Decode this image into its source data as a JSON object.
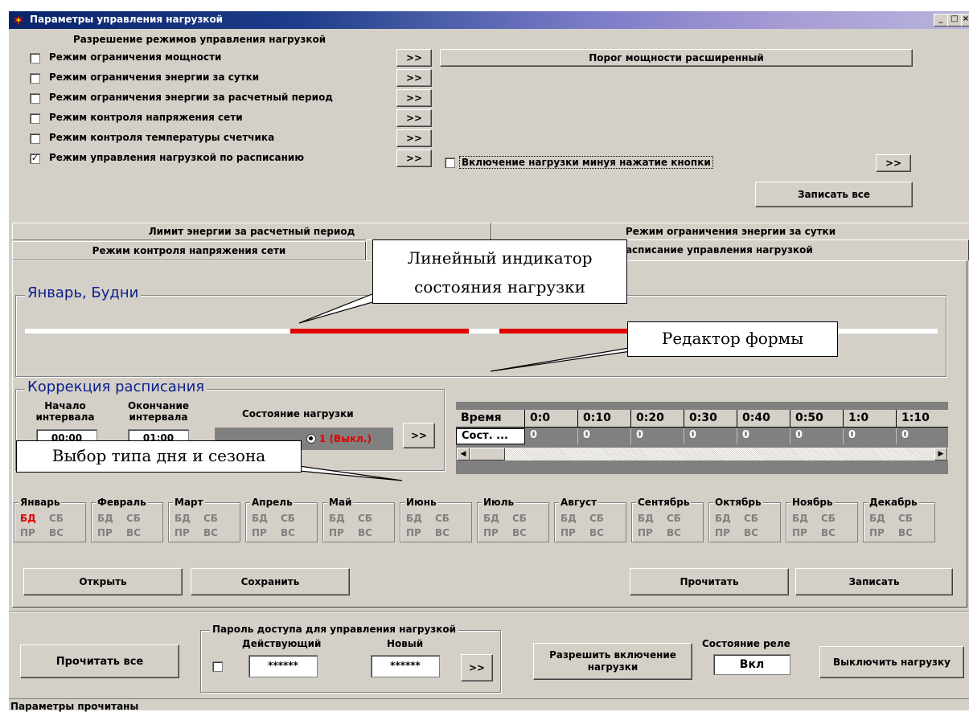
{
  "window": {
    "title": "Параметры управления нагрузкой"
  },
  "modes": {
    "caption": "Разрешение режимов управления нагрузкой",
    "items": [
      {
        "label": "Режим ограничения мощности",
        "checked": false
      },
      {
        "label": "Режим ограничения энергии за сутки",
        "checked": false
      },
      {
        "label": "Режим ограничения энергии за расчетный период",
        "checked": false
      },
      {
        "label": "Режим контроля напряжения сети",
        "checked": false
      },
      {
        "label": "Режим контроля температуры счетчика",
        "checked": false
      },
      {
        "label": "Режим управления нагрузкой по расписанию",
        "checked": true
      }
    ],
    "more_label": ">>",
    "check_mark": "✓",
    "power_threshold_button": "Порог мощности расширенный",
    "bypass_label": "Включение нагрузки минуя нажатие кнопки",
    "write_all_button": "Записать все"
  },
  "tabs": [
    "Лимит энергии за расчетный период",
    "Режим ограничения энергии за сутки",
    "Режим контроля напряжения сети",
    "Расписание управления нагрузкой"
  ],
  "schedule": {
    "title": "Январь, Будни"
  },
  "correction": {
    "caption": "Коррекция расписания",
    "start_label": "Начало интервала",
    "end_label": "Окончание интервала",
    "state_label": "Состояние нагрузки",
    "start_value": "00:00",
    "end_value": "01:00",
    "state_option": "1 (Выкл.)",
    "apply_label": ">>"
  },
  "grid": {
    "headers": [
      "Время",
      "0:0",
      "0:10",
      "0:20",
      "0:30",
      "0:40",
      "0:50",
      "1:0",
      "1:10"
    ],
    "row_label": "Сост. ...",
    "values": [
      "0",
      "0",
      "0",
      "0",
      "0",
      "0",
      "0",
      "0"
    ]
  },
  "months": [
    {
      "name": "Январь",
      "bd": "БД",
      "sb": "СБ",
      "pr": "ПР",
      "vs": "ВС",
      "selected": "bd"
    },
    {
      "name": "Февраль",
      "bd": "БД",
      "sb": "СБ",
      "pr": "ПР",
      "vs": "ВС"
    },
    {
      "name": "Март",
      "bd": "БД",
      "sb": "СБ",
      "pr": "ПР",
      "vs": "ВС"
    },
    {
      "name": "Апрель",
      "bd": "БД",
      "sb": "СБ",
      "pr": "ПР",
      "vs": "ВС"
    },
    {
      "name": "Май",
      "bd": "БД",
      "sb": "СБ",
      "pr": "ПР",
      "vs": "ВС"
    },
    {
      "name": "Июнь",
      "bd": "БД",
      "sb": "СБ",
      "pr": "ПР",
      "vs": "ВС"
    },
    {
      "name": "Июль",
      "bd": "БД",
      "sb": "СБ",
      "pr": "ПР",
      "vs": "ВС"
    },
    {
      "name": "Август",
      "bd": "БД",
      "sb": "СБ",
      "pr": "ПР",
      "vs": "ВС"
    },
    {
      "name": "Сентябрь",
      "bd": "БД",
      "sb": "СБ",
      "pr": "ПР",
      "vs": "ВС"
    },
    {
      "name": "Октябрь",
      "bd": "БД",
      "sb": "СБ",
      "pr": "ПР",
      "vs": "ВС"
    },
    {
      "name": "Ноябрь",
      "bd": "БД",
      "sb": "СБ",
      "pr": "ПР",
      "vs": "ВС"
    },
    {
      "name": "Декабрь",
      "bd": "БД",
      "sb": "СБ",
      "pr": "ПР",
      "vs": "ВС"
    }
  ],
  "actions": {
    "open": "Открыть",
    "save": "Сохранить",
    "read": "Прочитать",
    "write": "Записать"
  },
  "bottom": {
    "read_all": "Прочитать все",
    "password_caption": "Пароль доступа для управления нагрузкой",
    "current_label": "Действующий",
    "new_label": "Новый",
    "current_value": "******",
    "new_value": "******",
    "apply_label": ">>",
    "allow_button": "Разрешить включение нагрузки",
    "relay_label": "Состояние реле",
    "relay_value": "Вкл",
    "off_button": "Выключить нагрузку",
    "status": "Параметры прочитаны"
  },
  "callouts": {
    "indicator": "Линейный индикатор состояния нагрузки",
    "editor": "Редактор формы",
    "day_type": "Выбор типа дня и сезона"
  },
  "colors": {
    "on": "#e00000",
    "off": "#ffffff",
    "title_text": "#0b1f8c",
    "selected": "#e00000"
  }
}
